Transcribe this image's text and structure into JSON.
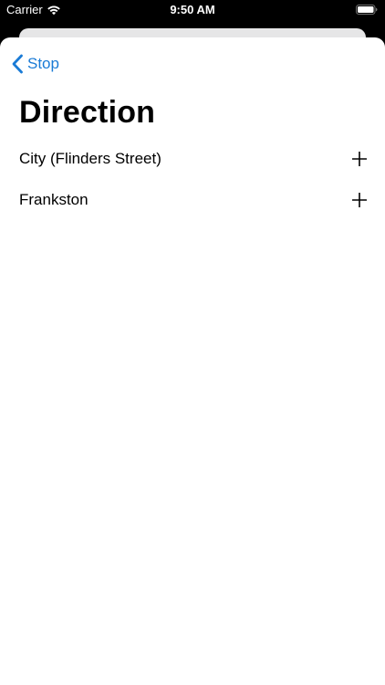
{
  "status_bar": {
    "carrier": "Carrier",
    "time": "9:50 AM",
    "wifi_icon": "wifi-icon",
    "battery_icon": "battery-icon"
  },
  "nav": {
    "back_label": "Stop",
    "back_icon": "chevron-left-icon",
    "accent_color": "#1a7bd6"
  },
  "page": {
    "title": "Direction"
  },
  "directions": [
    {
      "label": "City (Flinders Street)",
      "action_icon": "plus-icon"
    },
    {
      "label": "Frankston",
      "action_icon": "plus-icon"
    }
  ]
}
